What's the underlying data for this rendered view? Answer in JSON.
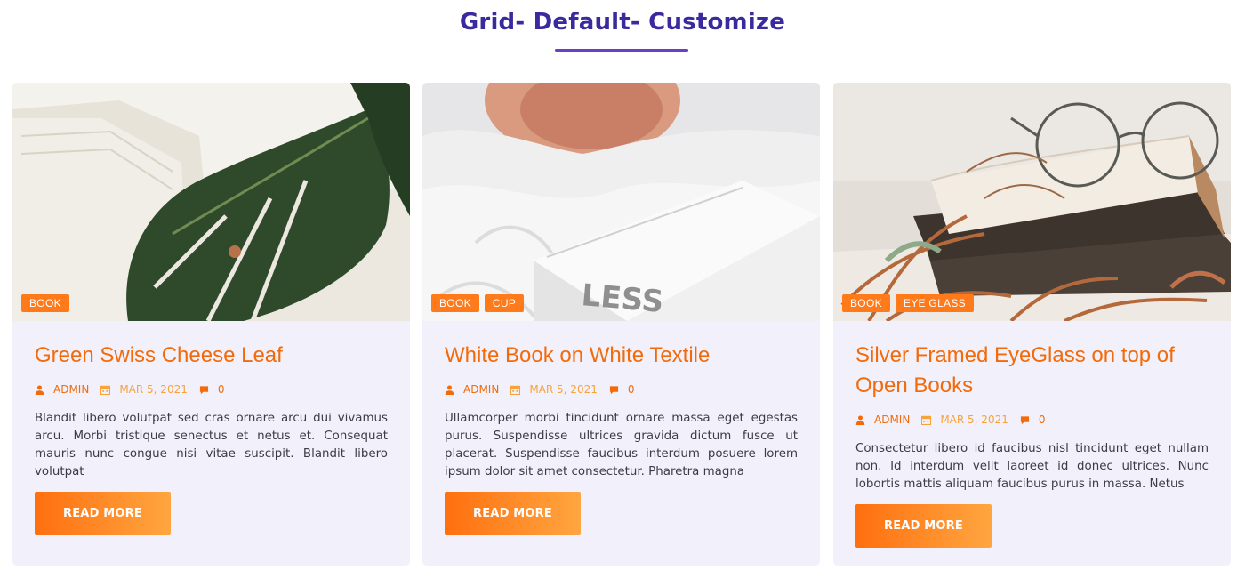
{
  "section": {
    "title": "Grid- Default- Customize"
  },
  "colors": {
    "title": "#3a2a9e",
    "underline": "#6a3fc4",
    "accent": "#f26a0a",
    "date": "#f7a33a",
    "card_bg": "#f2f1fb"
  },
  "posts": [
    {
      "tags": [
        "BOOK"
      ],
      "title": "Green Swiss Cheese Leaf",
      "author": "ADMIN",
      "date": "MAR 5, 2021",
      "comments": "0",
      "excerpt": "Blandit libero volutpat sed cras ornare arcu dui vivamus arcu. Morbi tristique senectus et netus et. Consequat mauris nunc congue nisi vitae suscipit. Blandit libero volutpat",
      "button": "READ MORE",
      "image_icon": "monstera-leaf-photo"
    },
    {
      "tags": [
        "BOOK",
        "CUP"
      ],
      "title": "White Book on White Textile",
      "author": "ADMIN",
      "date": "MAR 5, 2021",
      "comments": "0",
      "excerpt": "Ullamcorper morbi tincidunt ornare massa eget egestas purus. Suspendisse ultrices gravida dictum fusce ut placerat. Suspendisse faucibus interdum posuere lorem ipsum dolor sit amet consectetur. Pharetra magna",
      "button": "READ MORE",
      "image_text": "LESS",
      "image_icon": "white-book-photo"
    },
    {
      "tags": [
        "BOOK",
        "EYE GLASS"
      ],
      "title": "Silver Framed EyeGlass on top of Open Books",
      "author": "ADMIN",
      "date": "MAR 5, 2021",
      "comments": "0",
      "excerpt": "Consectetur libero id faucibus nisl tincidunt eget nullam non. Id interdum velit laoreet id donec ultrices. Nunc lobortis mattis aliquam faucibus purus in massa. Netus",
      "button": "READ MORE",
      "image_icon": "eyeglasses-books-photo"
    }
  ]
}
